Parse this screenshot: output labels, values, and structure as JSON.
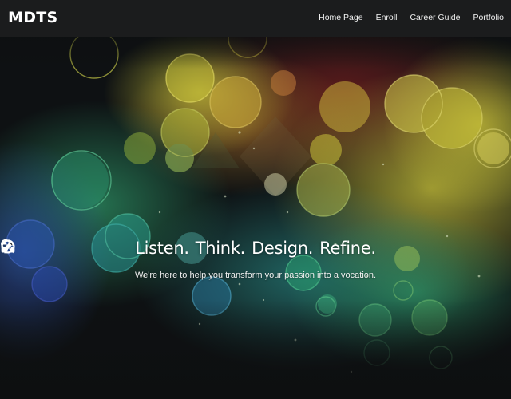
{
  "navbar": {
    "brand": "MDTS",
    "links": [
      {
        "label": "Home Page"
      },
      {
        "label": "Enroll"
      },
      {
        "label": "Career Guide"
      },
      {
        "label": "Portfolio"
      }
    ]
  },
  "hero": {
    "headline": [
      {
        "icon": "headphones-icon",
        "text": "Listen."
      },
      {
        "icon": "lightbulb-icon",
        "text": "Think."
      },
      {
        "icon": "pencil-icon",
        "text": "Design."
      },
      {
        "icon": "refresh-icon",
        "text": "Refine."
      }
    ],
    "tagline": "We're here to help you transform your passion into a vocation."
  },
  "colors": {
    "navbar_bg": "#1b1c1d",
    "text": "#ffffff",
    "bokeh_yellow": "#c9c23a",
    "bokeh_green": "#2f9a6a",
    "bokeh_blue": "#2b4a9a",
    "bokeh_red": "#7a1f1f"
  }
}
